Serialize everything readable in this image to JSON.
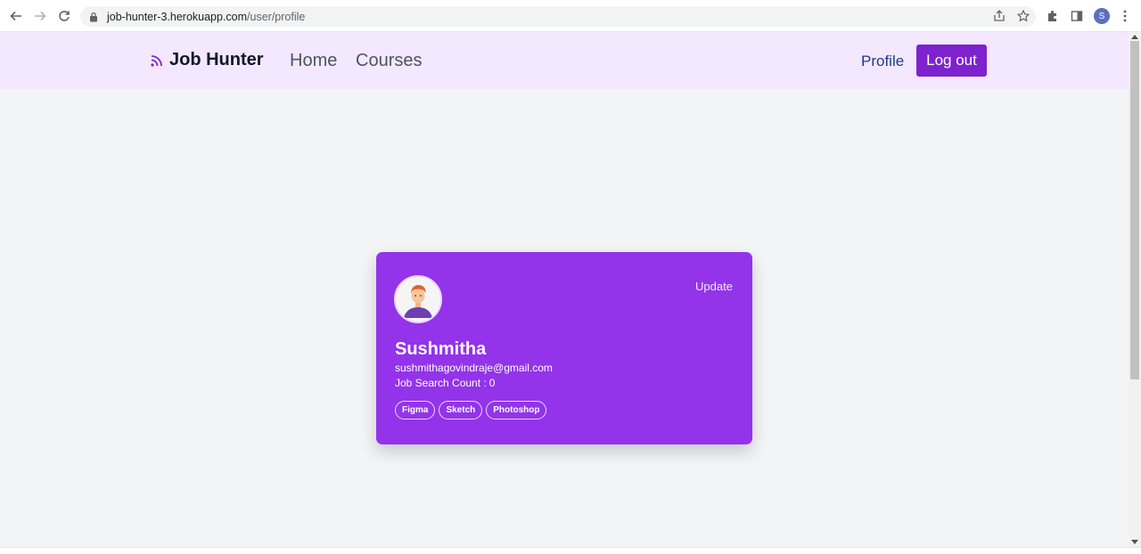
{
  "browser": {
    "url_host": "job-hunter-3.herokuapp.com",
    "url_path": "/user/profile",
    "profile_initial": "S"
  },
  "navbar": {
    "brand": "Job Hunter",
    "links": [
      "Home",
      "Courses"
    ],
    "profile_label": "Profile",
    "logout_label": "Log out"
  },
  "profile_card": {
    "update_label": "Update",
    "name": "Sushmitha",
    "email": "sushmithagovindraje@gmail.com",
    "job_search_label": "Job Search Count :",
    "job_search_count": "0",
    "skills": [
      "Figma",
      "Sketch",
      "Photoshop"
    ]
  },
  "colors": {
    "navbar_bg": "#f3e8ff",
    "card_bg": "#9333ea",
    "logout_bg": "#7e22ce",
    "profile_link": "#1e3a8a"
  },
  "icons": [
    "back-arrow-icon",
    "forward-arrow-icon",
    "reload-icon",
    "lock-icon",
    "share-icon",
    "star-icon",
    "extensions-icon",
    "sidebar-icon",
    "menu-dots-icon",
    "rss-icon",
    "avatar-illustration"
  ]
}
